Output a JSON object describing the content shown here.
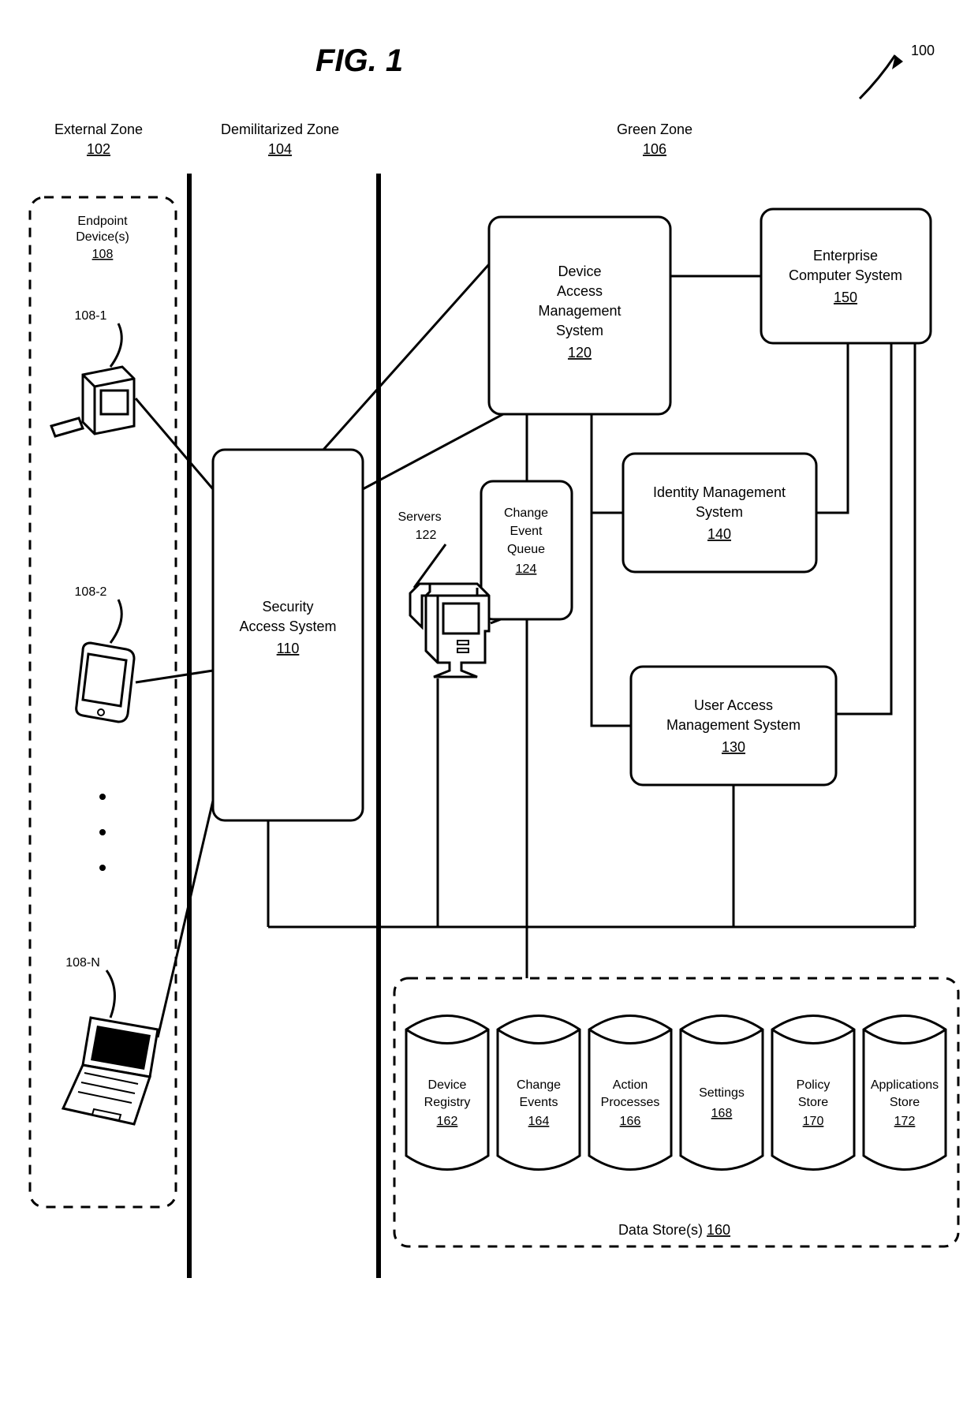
{
  "figure": {
    "title": "FIG. 1",
    "ref": "100"
  },
  "zones": {
    "external": {
      "label": "External Zone",
      "num": "102"
    },
    "dmz": {
      "label": "Demilitarized Zone",
      "num": "104"
    },
    "green": {
      "label": "Green Zone",
      "num": "106"
    }
  },
  "endpoints": {
    "group_label": "Endpoint",
    "group_label2": "Device(s)",
    "group_num": "108",
    "d1": "108-1",
    "d2": "108-2",
    "dn": "108-N"
  },
  "sas": {
    "l1": "Security",
    "l2": "Access System",
    "num": "110"
  },
  "dams": {
    "l1": "Device",
    "l2": "Access",
    "l3": "Management",
    "l4": "System",
    "num": "120"
  },
  "srv": {
    "label": "Servers",
    "num": "122"
  },
  "ceq": {
    "l1": "Change",
    "l2": "Event",
    "l3": "Queue",
    "num": "124"
  },
  "ims": {
    "l1": "Identity Management",
    "l2": "System",
    "num": "140"
  },
  "uams": {
    "l1": "User Access",
    "l2": "Management System",
    "num": "130"
  },
  "ecs": {
    "l1": "Enterprise",
    "l2": "Computer System",
    "num": "150"
  },
  "ds": {
    "label": "Data Store(s)",
    "num": "160"
  },
  "cyl": {
    "c1": {
      "l1": "Device",
      "l2": "Registry",
      "num": "162"
    },
    "c2": {
      "l1": "Change",
      "l2": "Events",
      "num": "164"
    },
    "c3": {
      "l1": "Action",
      "l2": "Processes",
      "num": "166"
    },
    "c4": {
      "l1": "Settings",
      "l2": "",
      "num": "168"
    },
    "c5": {
      "l1": "Policy",
      "l2": "Store",
      "num": "170"
    },
    "c6": {
      "l1": "Applications",
      "l2": "Store",
      "num": "172"
    }
  }
}
